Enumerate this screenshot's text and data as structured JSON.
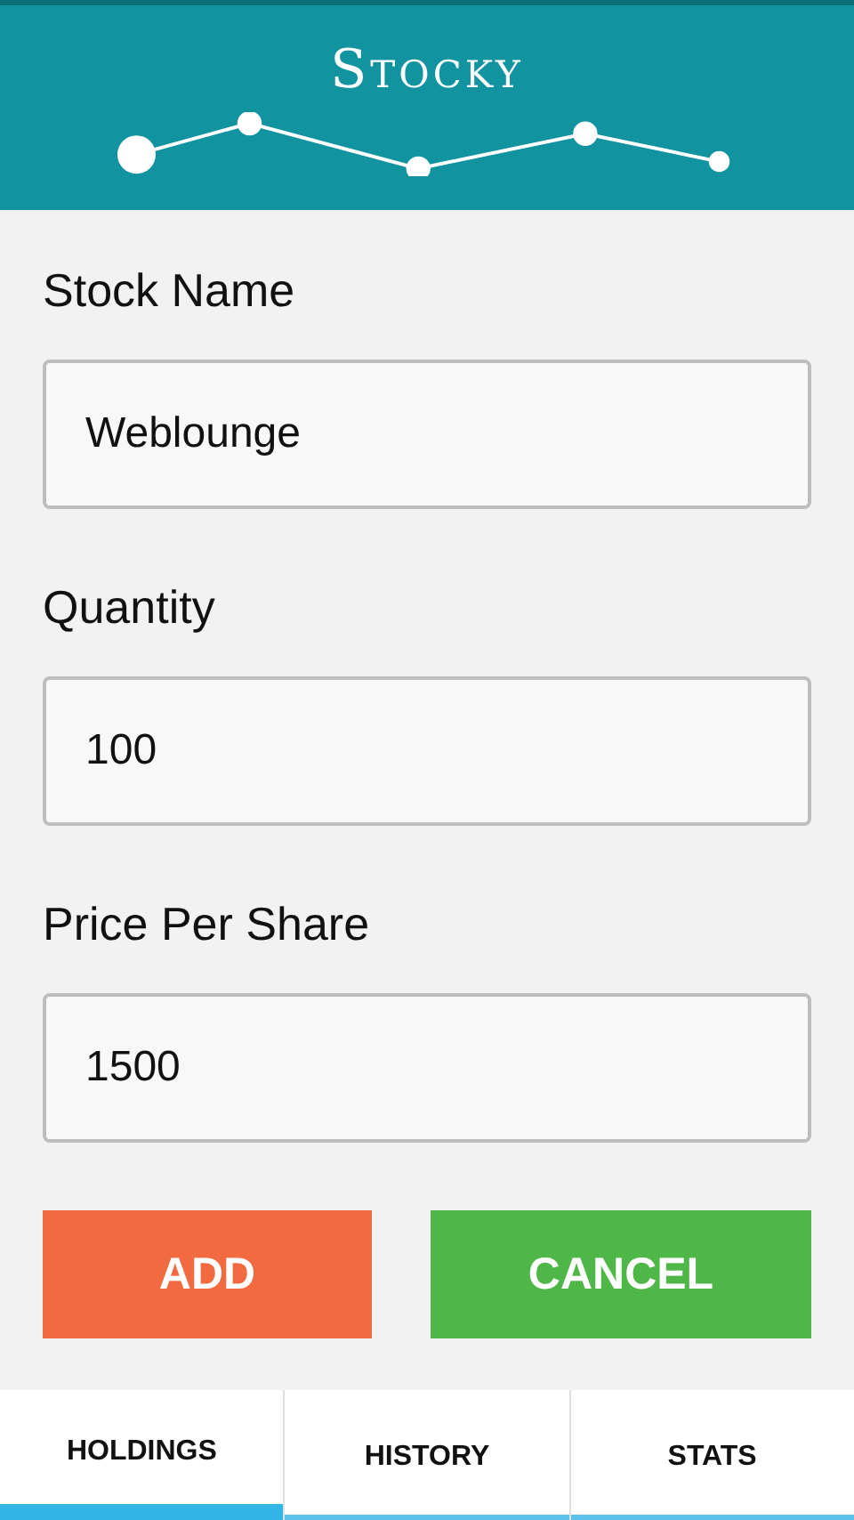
{
  "header": {
    "title": "Stocky"
  },
  "fields": [
    {
      "label": "Stock Name",
      "value": "Weblounge"
    },
    {
      "label": "Quantity",
      "value": "100"
    },
    {
      "label": "Price Per Share",
      "value": "1500"
    }
  ],
  "buttons": [
    {
      "label": "ADD",
      "kind": "primary"
    },
    {
      "label": "CANCEL",
      "kind": "secondary"
    }
  ],
  "tabs": [
    {
      "label": "HOLDINGS",
      "selected": true
    },
    {
      "label": "HISTORY",
      "selected": false
    },
    {
      "label": "STATS",
      "selected": false
    }
  ]
}
